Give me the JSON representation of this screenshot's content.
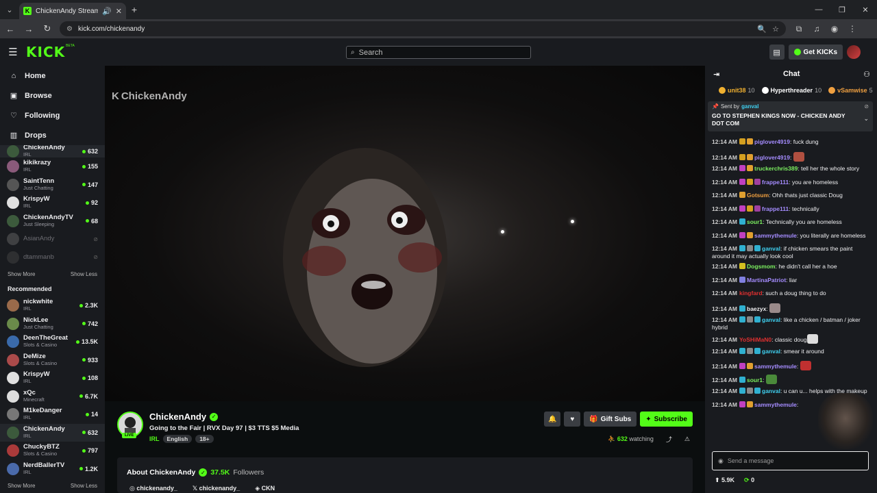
{
  "browser": {
    "tab_title": "ChickenAndy Stream - Wat",
    "url": "kick.com/chickenandy"
  },
  "header": {
    "logo": "KICK",
    "beta": "BETA",
    "search_placeholder": "Search",
    "get_kicks": "Get KICKs"
  },
  "sidebar": {
    "nav": [
      {
        "label": "Home",
        "icon": "home-icon"
      },
      {
        "label": "Browse",
        "icon": "browse-icon"
      },
      {
        "label": "Following",
        "icon": "heart-icon"
      },
      {
        "label": "Drops",
        "icon": "drops-icon"
      }
    ],
    "following": [
      {
        "name": "ChickenAndy",
        "category": "IRL",
        "viewers": "632",
        "color": "#3c5a3c"
      },
      {
        "name": "kikikrazy",
        "category": "IRL",
        "viewers": "155",
        "color": "#8a5a7a"
      },
      {
        "name": "SaintTenn",
        "category": "Just Chatting",
        "viewers": "147",
        "color": "#555"
      },
      {
        "name": "KrispyW",
        "category": "IRL",
        "viewers": "92",
        "color": "#e0e0e0"
      },
      {
        "name": "ChickenAndyTV",
        "category": "Just Sleeping",
        "viewers": "68",
        "color": "#3c5a3c"
      }
    ],
    "offline": [
      {
        "name": "AsianAndy",
        "color": "#666"
      },
      {
        "name": "dtammanb",
        "color": "#444"
      }
    ],
    "show_more": "Show More",
    "show_less": "Show Less",
    "recommended_title": "Recommended",
    "recommended": [
      {
        "name": "nickwhite",
        "category": "IRL",
        "viewers": "2.3K",
        "color": "#9a6a4a"
      },
      {
        "name": "NickLee",
        "category": "Just Chatting",
        "viewers": "742",
        "color": "#6a8a4a"
      },
      {
        "name": "DeenTheGreat",
        "category": "Slots & Casino",
        "viewers": "13.5K",
        "color": "#3a6aaa"
      },
      {
        "name": "DeMize",
        "category": "Slots & Casino",
        "viewers": "933",
        "color": "#aa4a4a"
      },
      {
        "name": "KrispyW",
        "category": "IRL",
        "viewers": "108",
        "color": "#e0e0e0"
      },
      {
        "name": "xQc",
        "category": "Minecraft",
        "viewers": "6.7K",
        "color": "#ddd"
      },
      {
        "name": "M1keDanger",
        "category": "IRL",
        "viewers": "14",
        "color": "#777"
      },
      {
        "name": "ChickenAndy",
        "category": "IRL",
        "viewers": "632",
        "color": "#3c5a3c"
      },
      {
        "name": "ChuckyBTZ",
        "category": "Slots & Casino",
        "viewers": "797",
        "color": "#aa3a3a"
      },
      {
        "name": "NerdBallerTV",
        "category": "IRL",
        "viewers": "1.2K",
        "color": "#4a6aaa"
      }
    ]
  },
  "video": {
    "watermark": "ChickenAndy"
  },
  "stream": {
    "name": "ChickenAndy",
    "title": "Going to the Fair | RVX Day 97 | $3 TTS $5 Media",
    "category": "IRL",
    "tags": [
      "English",
      "18+"
    ],
    "live": "LIVE",
    "gift_subs": "Gift Subs",
    "subscribe": "Subscribe",
    "watching_count": "632",
    "watching_label": "watching"
  },
  "about": {
    "title": "About ChickenAndy",
    "followers_count": "37.5K",
    "followers_label": "Followers",
    "socials": [
      "chickenandy_",
      "chickenandy_",
      "CKN"
    ]
  },
  "chat": {
    "title": "Chat",
    "leaders": [
      {
        "name": "unit38",
        "count": "10",
        "color": "#f0b030"
      },
      {
        "name": "Hyperthreader",
        "count": "10",
        "color": "#ffffff"
      },
      {
        "name": "vSamwise",
        "count": "5",
        "color": "#f0a040"
      }
    ],
    "pinned": {
      "sent_by": "Sent by",
      "author": "ganval",
      "message": "GO TO STEPHEN KINGS NOW - CHICKEN ANDY DOT COM"
    },
    "messages": [
      {
        "time": "12:14 AM",
        "user": "piglover4919",
        "color": "#a58cff",
        "text": "fuck dung",
        "badges": [
          "#d4a020",
          "#e0a030"
        ]
      },
      {
        "time": "12:14 AM",
        "user": "piglover4919",
        "color": "#a58cff",
        "text": "",
        "badges": [
          "#d4a020",
          "#e0a030"
        ],
        "emote": "#b05040"
      },
      {
        "time": "12:14 AM",
        "user": "truckerchris389",
        "color": "#7cf060",
        "text": "tell her the whole story",
        "badges": [
          "#c040c0",
          "#e0a030"
        ]
      },
      {
        "time": "12:14 AM",
        "user": "frappe111",
        "color": "#a58cff",
        "text": "you are homeless",
        "badges": [
          "#c040c0",
          "#d4a020",
          "#a040a0"
        ]
      },
      {
        "time": "12:14 AM",
        "user": "Gotsum",
        "color": "#f0a040",
        "text": "Ohh thats just classic Doug",
        "badges": [
          "#e0a030"
        ]
      },
      {
        "time": "12:14 AM",
        "user": "frappe111",
        "color": "#a58cff",
        "text": "technically",
        "badges": [
          "#c040c0",
          "#d4a020",
          "#a040a0"
        ]
      },
      {
        "time": "12:14 AM",
        "user": "sour1",
        "color": "#7cf060",
        "text": "Technically you are homeless",
        "badges": [
          "#30b0d0"
        ]
      },
      {
        "time": "12:14 AM",
        "user": "sammythemule",
        "color": "#a58cff",
        "text": "you literally are homeless",
        "badges": [
          "#c040c0",
          "#e0a030"
        ]
      },
      {
        "time": "12:14 AM",
        "user": "ganval",
        "color": "#3fd0f0",
        "text": "if chicken smears the paint around it may actually look cool",
        "badges": [
          "#30b0d0",
          "#888",
          "#30b0d0"
        ]
      },
      {
        "time": "12:14 AM",
        "user": "Dogsmom",
        "color": "#7cf060",
        "text": "he didn't call her a hoe",
        "badges": [
          "#d4c020"
        ]
      },
      {
        "time": "12:14 AM",
        "user": "MartinaPatriot",
        "color": "#a58cff",
        "text": "liar",
        "badges": [
          "#8080e0"
        ]
      },
      {
        "time": "12:14 AM",
        "user": "kingfard",
        "color": "#e03030",
        "text": "such a doug thing to do",
        "badges": []
      },
      {
        "time": "12:14 AM",
        "user": "baezyx",
        "color": "#efeff1",
        "text": "",
        "badges": [
          "#30b0d0"
        ],
        "emote": "#9a8a8a"
      },
      {
        "time": "12:14 AM",
        "user": "ganval",
        "color": "#3fd0f0",
        "text": "like a chicken / batman / joker hybrid",
        "badges": [
          "#30b0d0",
          "#888",
          "#30b0d0"
        ]
      },
      {
        "time": "12:14 AM",
        "user": "YoSHiMaN0",
        "color": "#e03030",
        "text": "classic doug",
        "badges": [],
        "emote": "#ddd"
      },
      {
        "time": "12:14 AM",
        "user": "ganval",
        "color": "#3fd0f0",
        "text": "smear it around",
        "badges": [
          "#30b0d0",
          "#888",
          "#30b0d0"
        ]
      },
      {
        "time": "12:14 AM",
        "user": "sammythemule",
        "color": "#a58cff",
        "text": "",
        "badges": [
          "#c040c0",
          "#e0a030"
        ],
        "emote": "#c03030"
      },
      {
        "time": "12:14 AM",
        "user": "sour1",
        "color": "#7cf060",
        "text": "",
        "badges": [
          "#30b0d0"
        ],
        "emote": "#4a8a3a"
      },
      {
        "time": "12:14 AM",
        "user": "ganval",
        "color": "#3fd0f0",
        "text": "u can u... helps with the makeup",
        "badges": [
          "#30b0d0",
          "#888",
          "#30b0d0"
        ]
      },
      {
        "time": "12:14 AM",
        "user": "sammythemule",
        "color": "#a58cff",
        "text": "",
        "badges": [
          "#c040c0",
          "#e0a030"
        ]
      }
    ],
    "input_placeholder": "Send a message",
    "stat1": "5.9K",
    "stat2": "0"
  },
  "colors": {
    "accent": "#53fc18",
    "bg": "#0b0e0f",
    "panel": "#191b1f"
  }
}
